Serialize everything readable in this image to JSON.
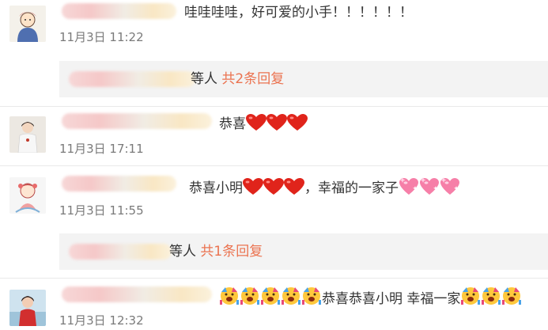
{
  "comments": [
    {
      "text": "哇哇哇哇，好可爱的小手！！！！！！",
      "time": "11月3日 11:22"
    },
    {
      "text": "恭喜",
      "time": "11月3日 17:11"
    },
    {
      "text_1": "恭喜小明",
      "text_2": "，幸福的一家子",
      "time": "11月3日 11:55"
    },
    {
      "text_1": "恭喜恭喜小明 幸福一家",
      "time": "11月3日 12:32"
    }
  ],
  "replies": [
    {
      "suffix": "等人",
      "link": "共2条回复"
    },
    {
      "suffix": "等人",
      "link": "共1条回复"
    }
  ],
  "icons": {
    "heart": "red-heart-icon",
    "sparkle_heart": "sparkling-heart-icon",
    "party_face": "party-face-icon"
  },
  "colors": {
    "link": "#eb7350",
    "heart": "#e0241b",
    "sparkle_heart": "#f67fa8",
    "party": "#ffc83d"
  }
}
